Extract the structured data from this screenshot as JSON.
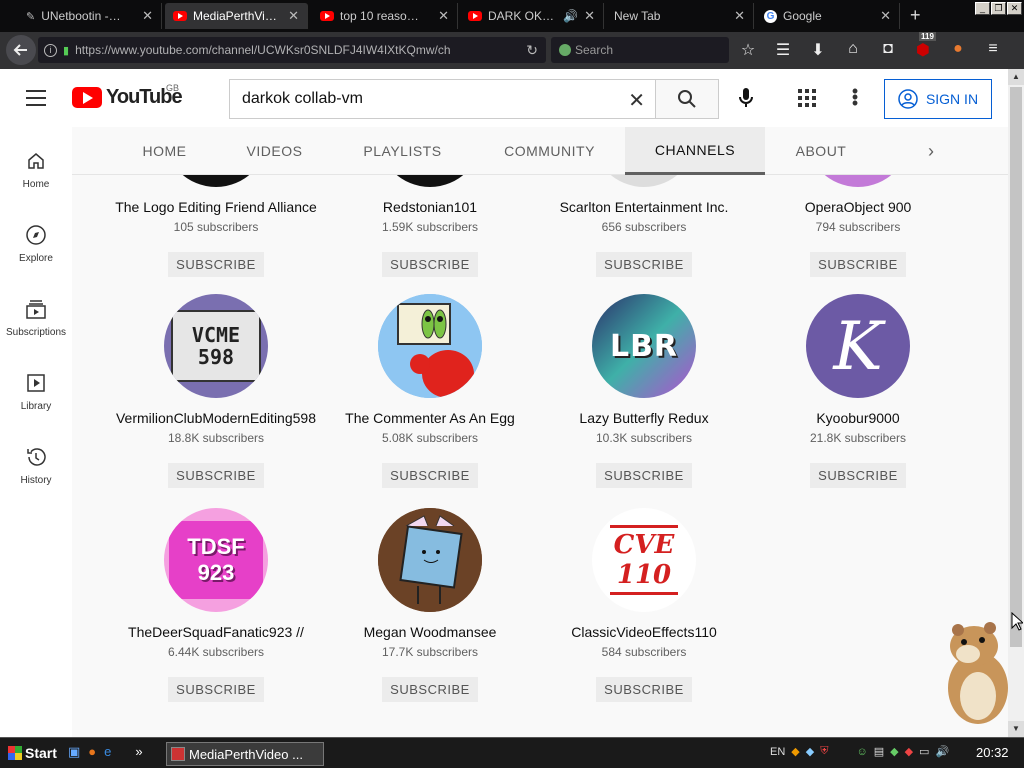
{
  "browser": {
    "tabs": [
      {
        "title": "UNetbootin -…",
        "icon": "tool-icon"
      },
      {
        "title": "MediaPerthVi…",
        "icon": "youtube-icon",
        "active": true
      },
      {
        "title": "top 10 reaso…",
        "icon": "youtube-icon"
      },
      {
        "title": "DARK OK…",
        "icon": "youtube-icon"
      },
      {
        "title": "New Tab",
        "icon": ""
      },
      {
        "title": "Google",
        "icon": "google-icon"
      }
    ],
    "url": "https://www.youtube.com/channel/UCWKsr0SNLDFJ4IW4IXtKQmw/ch",
    "search_placeholder": "Search",
    "badge_count": "119"
  },
  "youtube": {
    "logo_text": "YouTube",
    "region": "GB",
    "search_value": "darkok collab-vm",
    "signin_label": "SIGN IN",
    "left_nav": [
      {
        "label": "Home",
        "icon": "home-icon"
      },
      {
        "label": "Explore",
        "icon": "compass-icon"
      },
      {
        "label": "Subscriptions",
        "icon": "subscriptions-icon"
      },
      {
        "label": "Library",
        "icon": "library-icon"
      },
      {
        "label": "History",
        "icon": "history-icon"
      }
    ],
    "channel_tabs": [
      "HOME",
      "VIDEOS",
      "PLAYLISTS",
      "COMMUNITY",
      "CHANNELS",
      "ABOUT"
    ],
    "selected_tab": "CHANNELS",
    "subscribe_label": "SUBSCRIBE",
    "channels": [
      {
        "name": "The Logo Editing Friend Alliance",
        "subs": "105 subscribers"
      },
      {
        "name": "Redstonian101",
        "subs": "1.59K subscribers"
      },
      {
        "name": "Scarlton Entertainment Inc.",
        "subs": "656 subscribers"
      },
      {
        "name": "OperaObject 900",
        "subs": "794 subscribers"
      },
      {
        "name": "VermilionClubModernEditing598",
        "subs": "18.8K subscribers",
        "avatar_text": "VCME 598"
      },
      {
        "name": "The Commenter As An Egg",
        "subs": "5.08K subscribers"
      },
      {
        "name": "Lazy Butterfly Redux",
        "subs": "10.3K subscribers",
        "avatar_text": "LBR"
      },
      {
        "name": "Kyoobur9000",
        "subs": "21.8K subscribers",
        "avatar_text": "K"
      },
      {
        "name": "TheDeerSquadFanatic923 //",
        "subs": "6.44K subscribers",
        "avatar_text": "TDSF 923"
      },
      {
        "name": "Megan Woodmansee",
        "subs": "17.7K subscribers"
      },
      {
        "name": "ClassicVideoEffects110",
        "subs": "584 subscribers",
        "avatar_text": "CVE 110"
      }
    ]
  },
  "taskbar": {
    "start_label": "Start",
    "task_label": "MediaPerthVideo ...",
    "lang": "EN",
    "clock": "20:32"
  },
  "colors": {
    "accent_blue": "#065fd4",
    "yt_red": "#ff0000",
    "taskbar": "#1a1a1a"
  }
}
